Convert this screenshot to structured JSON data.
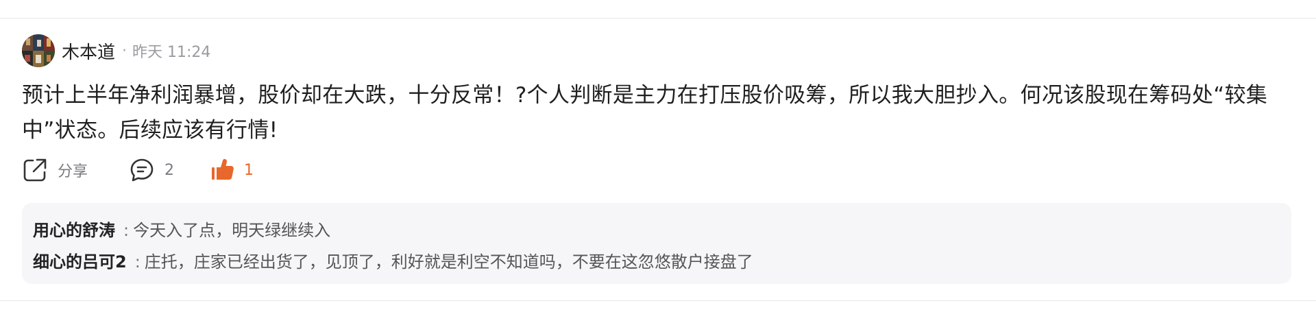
{
  "post": {
    "author": "木本道",
    "meta_dot": "·",
    "time": "昨天 11:24",
    "content": "预计上半年净利润暴增，股价却在大跌，十分反常！?个人判断是主力在打压股价吸筹，所以我大胆抄入。何况该股现在筹码处“较集中”状态。后续应该有行情!"
  },
  "actions": {
    "share_label": "分享",
    "comment_count": "2",
    "like_count": "1",
    "share_icon": "share-icon",
    "comment_icon": "comment-icon",
    "like_icon": "thumbs-up-icon"
  },
  "replies": [
    {
      "user": "用心的舒涛",
      "separator": ":",
      "text": "今天入了点，明天绿继续入"
    },
    {
      "user": "细心的吕可2",
      "separator": ":",
      "text": "庄托，庄家已经出货了，见顶了，利好就是利空不知道吗，不要在这忽悠散户接盘了"
    }
  ],
  "colors": {
    "like_accent": "#e8672a",
    "reply_background": "#f6f6f8",
    "divider": "#e7e7ea"
  }
}
